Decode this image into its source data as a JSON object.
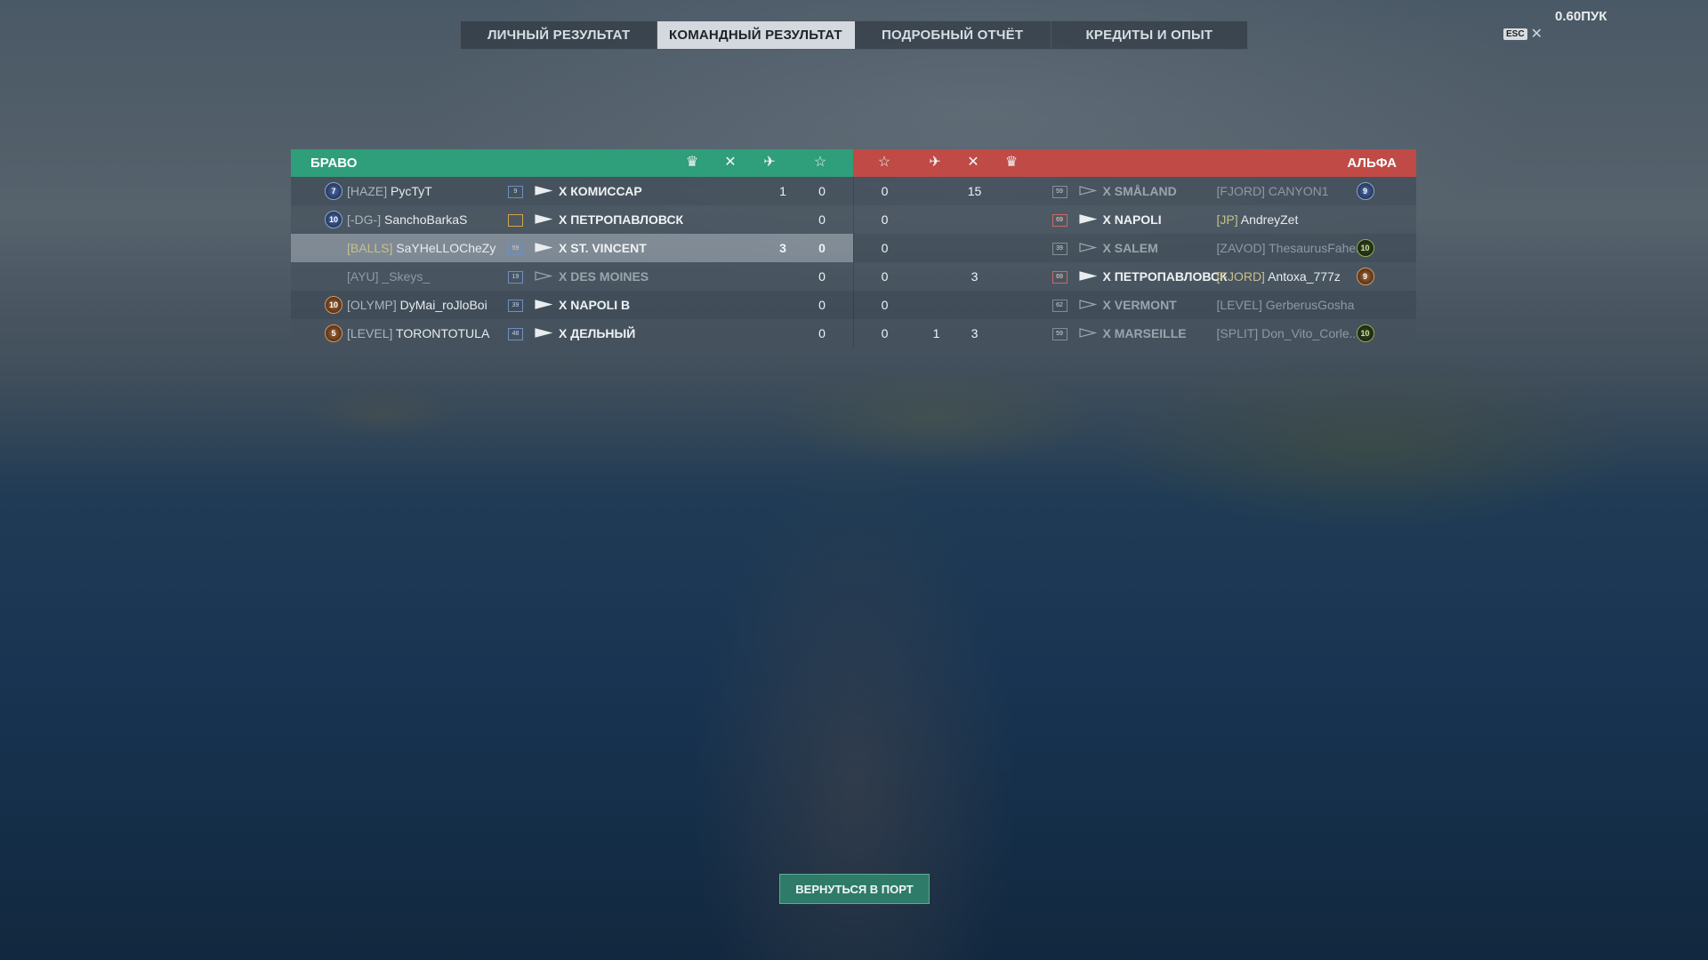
{
  "tabs": [
    {
      "label": "ЛИЧНЫЙ РЕЗУЛЬТАТ"
    },
    {
      "label": "КОМАНДНЫЙ РЕЗУЛЬТАТ"
    },
    {
      "label": "ПОДРОБНЫЙ ОТЧЁТ"
    },
    {
      "label": "КРЕДИТЫ И ОПЫТ"
    }
  ],
  "active_tab": 1,
  "esc": {
    "key": "ESC",
    "close": "✕"
  },
  "version": "0.60ПУК",
  "teams": {
    "left_name": "БРАВО",
    "right_name": "АЛЬФА",
    "header_icons": [
      "laurel-icon",
      "crossed-guns-icon",
      "plane-icon",
      "star-icon"
    ]
  },
  "left_players": [
    {
      "rank": "7",
      "rank_style": "blue",
      "clan": "[HAZE]",
      "name": "PycTyT",
      "badge": "9",
      "ship": "X КОМИССАР",
      "c2": "1",
      "c1": "0"
    },
    {
      "rank": "10",
      "rank_style": "blue",
      "clan": "[-DG-]",
      "name": "SanchoBarkaS",
      "badge": "",
      "ship": "X ПЕТРОПАВЛОВСК",
      "c2": "",
      "c1": "0"
    },
    {
      "rank": "",
      "rank_style": "",
      "clan": "[BALLS]",
      "name": "SaYHeLLOCheZy",
      "badge": "59",
      "ship": "X ST. VINCENT",
      "c2": "3",
      "c1": "0"
    },
    {
      "rank": "",
      "rank_style": "",
      "clan": "[AYU]",
      "name": "_Skeys_",
      "badge": "19",
      "ship": "X DES MOINES",
      "c2": "",
      "c1": "0"
    },
    {
      "rank": "10",
      "rank_style": "bronze",
      "clan": "[OLYMP]",
      "name": "DyMai_roJloBoi",
      "badge": "39",
      "ship": "X NAPOLI B",
      "c2": "",
      "c1": "0"
    },
    {
      "rank": "5",
      "rank_style": "bronze",
      "clan": "[LEVEL]",
      "name": "TORONTOTULA",
      "badge": "48",
      "ship": "X ДЕЛЬНЫЙ",
      "c2": "",
      "c1": "0"
    }
  ],
  "right_players": [
    {
      "s0": "0",
      "s1": "",
      "s2": "15",
      "badge": "59",
      "ship": "X SMÅLAND",
      "clan": "[FJORD]",
      "name": "CANYON1",
      "rank": "9",
      "rank_style": "blue"
    },
    {
      "s0": "0",
      "s1": "",
      "s2": "",
      "badge": "69",
      "ship": "X NAPOLI",
      "clan": "[JP]",
      "name": "AndreyZet",
      "rank": "",
      "rank_style": ""
    },
    {
      "s0": "0",
      "s1": "",
      "s2": "",
      "badge": "39",
      "ship": "X SALEM",
      "clan": "[ZAVOD]",
      "name": "ThesaurusFahen",
      "rank": "10",
      "rank_style": "green"
    },
    {
      "s0": "0",
      "s1": "",
      "s2": "3",
      "badge": "69",
      "ship": "X ПЕТРОПАВЛОВСК",
      "clan": "[FJORD]",
      "name": "Antoxa_777z",
      "rank": "9",
      "rank_style": "bronze"
    },
    {
      "s0": "0",
      "s1": "",
      "s2": "",
      "badge": "62",
      "ship": "X VERMONT",
      "clan": "[LEVEL]",
      "name": "GerberusGosha",
      "rank": "",
      "rank_style": ""
    },
    {
      "s0": "0",
      "s1": "1",
      "s2": "3",
      "badge": "59",
      "ship": "X MARSEILLE",
      "clan": "[SPLIT]",
      "name": "Don_Vito_Corle...",
      "rank": "10",
      "rank_style": "green"
    }
  ],
  "return_button": "ВЕРНУТЬСЯ В ПОРТ"
}
